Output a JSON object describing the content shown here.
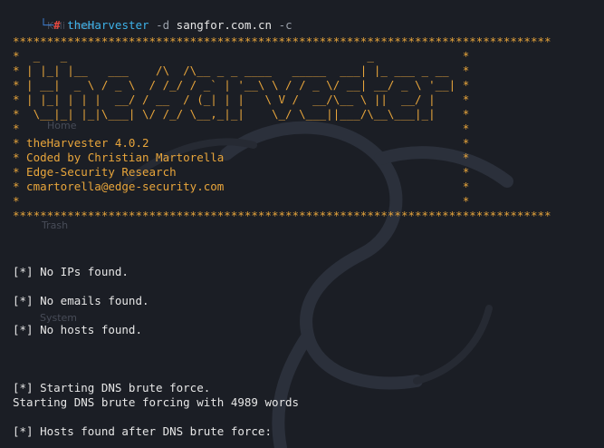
{
  "prompt": {
    "symbol": "#",
    "command": "theHarvester",
    "flag1": "-d",
    "domain": "sangfor.com.cn",
    "flag2": "-c"
  },
  "banner": {
    "border": "*******************************************************************************",
    "art": [
      "*  _   _                                            _             *",
      "* | |_| |__   ___    /\\  /\\__ _ _ ____   _____  ___| |_ ___ _ __  *",
      "* | __|  _ \\ / _ \\  / /_/ / _` | '__\\ \\ / / _ \\/ __| __/ _ \\ '__| *",
      "* | |_| | | |  __/ / __  / (_| | |   \\ V /  __/\\__ \\ ||  __/ |    *",
      "*  \\__|_| |_|\\___| \\/ /_/ \\__,_|_|    \\_/ \\___||___/\\__\\___|_|    *"
    ],
    "blank": "*                                                                 *",
    "info": [
      "* theHarvester 4.0.2                                              *",
      "* Coded by Christian Martorella                                   *",
      "* Edge-Security Research                                          *",
      "* cmartorella@edge-security.com                                   *"
    ]
  },
  "output": {
    "no_ips": "[*] No IPs found.",
    "no_emails": "[*] No emails found.",
    "no_hosts": "[*] No hosts found.",
    "dns_start": "[*] Starting DNS brute force.",
    "dns_words": "Starting DNS brute forcing with 4989 words",
    "hosts_after": "[*] Hosts found after DNS brute force:"
  },
  "desktop_icons": [
    "Kali Linux",
    "Home",
    "Trash",
    "System"
  ]
}
